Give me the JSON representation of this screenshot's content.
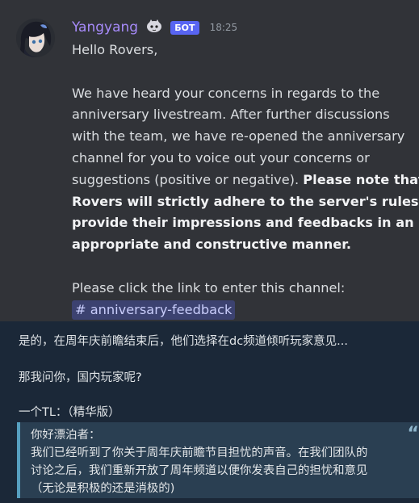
{
  "discord": {
    "username": "Yangyang",
    "bot_badge": "БОТ",
    "timestamp": "18:25",
    "greeting": "Hello Rovers,",
    "para1_lines": [
      "We have heard your concerns in regards to the",
      "anniversary livestream. After further discussions",
      "with the team, we have re-opened the anniversary",
      "channel for you to voice out your concerns or"
    ],
    "para1_tail": "suggestions (positive or negative). ",
    "para1_bold_inline": "Please note that",
    "para1_bold_lines": [
      "Rovers will strictly adhere to the server's rules and",
      "provide their impressions and feedbacks in an",
      "appropriate and constructive manner."
    ],
    "link_prompt": "Please click the link to enter this channel:",
    "channel": "# anniversary-feedback"
  },
  "comment": {
    "line1": "是的，在周年庆前瞻结束后，他们选择在dc频道倾听玩家意见...",
    "line2": "那我问你，国内玩家呢?",
    "line3": "一个TL：（精华版）",
    "quote_mark": "“",
    "quote_lines": [
      "你好漂泊者：",
      "我们已经听到了你关于周年庆前瞻节目担忧的声音。在我们团队的",
      "讨论之后，我们重新开放了周年频道以便你发表自己的担忧和意见",
      "（无论是积极的还是消极的)"
    ]
  }
}
